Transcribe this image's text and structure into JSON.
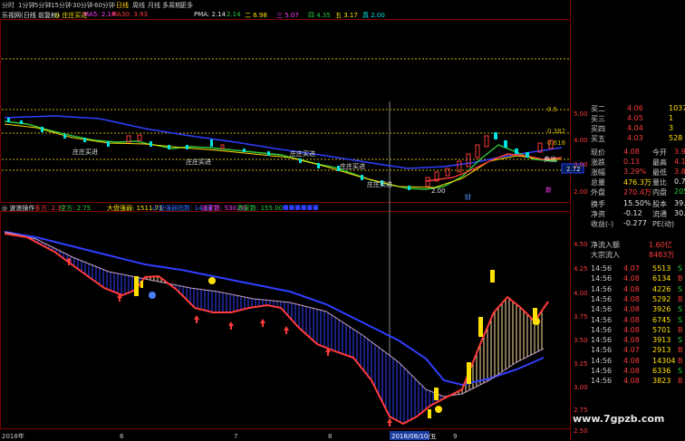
{
  "toolbar": {
    "items": [
      "分时",
      "1分钟",
      "5分钟",
      "15分钟",
      "30分钟",
      "60分钟",
      "日线",
      "周线",
      "月线",
      "多周期",
      "更多"
    ],
    "active_index": 6
  },
  "info_bar": {
    "stock_title": "乐视网(日线 前复权)",
    "indicator": "◎ 庄庄买进",
    "ma5": "MA5: 2.14",
    "ma30": "MA30: 3.93",
    "pma_label": "PMA: 2.14",
    "v1": "2.14",
    "v2": "二 6.98",
    "v3": "三 5.07",
    "v4": "四 4.35",
    "v5": "五 3.17",
    "v6": "真 2.00"
  },
  "sub_bar": {
    "title": "◎ 波浪操作",
    "dir_label": "多方: 2.17",
    "kong_label": "空方: 2.75",
    "dapan": "大盘强弱: 1511.71",
    "xiao": "小盘强弱指数: 14.10",
    "zhang": "涨家数: 530.00",
    "die": "跌家数: 155.00",
    "extra": "■■■■■■"
  },
  "main_chart": {
    "price_axis": [
      "5.00",
      "4.00",
      "3.00",
      "2.00"
    ],
    "ref_labels": [
      "0.5",
      "0.382",
      "0.618"
    ],
    "current_tag": "2.72",
    "annotations": [
      "庄庄买进",
      "庄庄买进",
      "庄庄买进",
      "庄庄买进",
      "庄庄买进",
      "财",
      "新",
      "2.00",
      "卖出"
    ],
    "hline_dates": ""
  },
  "sub_chart": {
    "price_axis": [
      "4.50",
      "4.25",
      "4.00",
      "3.75",
      "3.50",
      "3.25",
      "3.00",
      "2.75",
      "2.50"
    ]
  },
  "date_axis": {
    "start": "2018年",
    "ticks": [
      "6",
      "7",
      "8",
      "9"
    ],
    "cursor": "2018/08/10/五"
  },
  "right_panel": {
    "asks": [
      {
        "label": "买二",
        "price": "4.06",
        "vol": "1037"
      },
      {
        "label": "买三",
        "price": "4.05",
        "vol": "1"
      },
      {
        "label": "买四",
        "price": "4.04",
        "vol": "3"
      },
      {
        "label": "买五",
        "price": "4.03",
        "vol": "528"
      }
    ],
    "quote": [
      {
        "k1": "现价",
        "v1": "4.08",
        "k2": "今开",
        "v2": "3.9"
      },
      {
        "k1": "涨跌",
        "v1": "0.13",
        "k2": "最高",
        "v2": "4.1"
      },
      {
        "k1": "涨幅",
        "v1": "3.29%",
        "k2": "最低",
        "v2": "3.8"
      },
      {
        "k1": "总量",
        "v1": "476.3万",
        "k2": "量比",
        "v2": "0.7"
      },
      {
        "k1": "外盘",
        "v1": "270.4万",
        "k2": "内盘",
        "v2": "205.9"
      },
      {
        "k1": "换手",
        "v1": "15.50%",
        "k2": "股本",
        "v2": "39.9"
      },
      {
        "k1": "净资",
        "v1": "-0.12",
        "k2": "流通",
        "v2": "30.7"
      },
      {
        "k1": "收益(-)",
        "v1": "-0.277",
        "k2": "PE(动)",
        "v2": ""
      }
    ],
    "flows": [
      {
        "k": "净流入额",
        "v": "1.60亿"
      },
      {
        "k": "大宗流入",
        "v": "8483万"
      }
    ],
    "ticks": [
      {
        "t": "14:56",
        "p": "4.07",
        "v": "5513",
        "d": "S"
      },
      {
        "t": "14:56",
        "p": "4.08",
        "v": "6134",
        "d": "B"
      },
      {
        "t": "14:56",
        "p": "4.08",
        "v": "4226",
        "d": "S"
      },
      {
        "t": "14:56",
        "p": "4.08",
        "v": "5292",
        "d": "B"
      },
      {
        "t": "14:56",
        "p": "4.08",
        "v": "3926",
        "d": "S"
      },
      {
        "t": "14:56",
        "p": "4.08",
        "v": "6745",
        "d": "S"
      },
      {
        "t": "14:56",
        "p": "4.08",
        "v": "5701",
        "d": "B"
      },
      {
        "t": "14:56",
        "p": "4.08",
        "v": "3913",
        "d": "S"
      },
      {
        "t": "14:56",
        "p": "4.07",
        "v": "2913",
        "d": "B"
      },
      {
        "t": "14:56",
        "p": "4.08",
        "v": "14304",
        "d": "B"
      },
      {
        "t": "14:56",
        "p": "4.08",
        "v": "6336",
        "d": "S"
      },
      {
        "t": "14:56",
        "p": "4.08",
        "v": "3823",
        "d": "B"
      }
    ]
  },
  "watermark": "www.7gpzb.com",
  "colors": {
    "up": "#ff3b3b",
    "down": "#00e0e0",
    "ma_yellow": "#ffe000",
    "ma_blue": "#2f3fff",
    "ref_line": "#c8b400"
  }
}
